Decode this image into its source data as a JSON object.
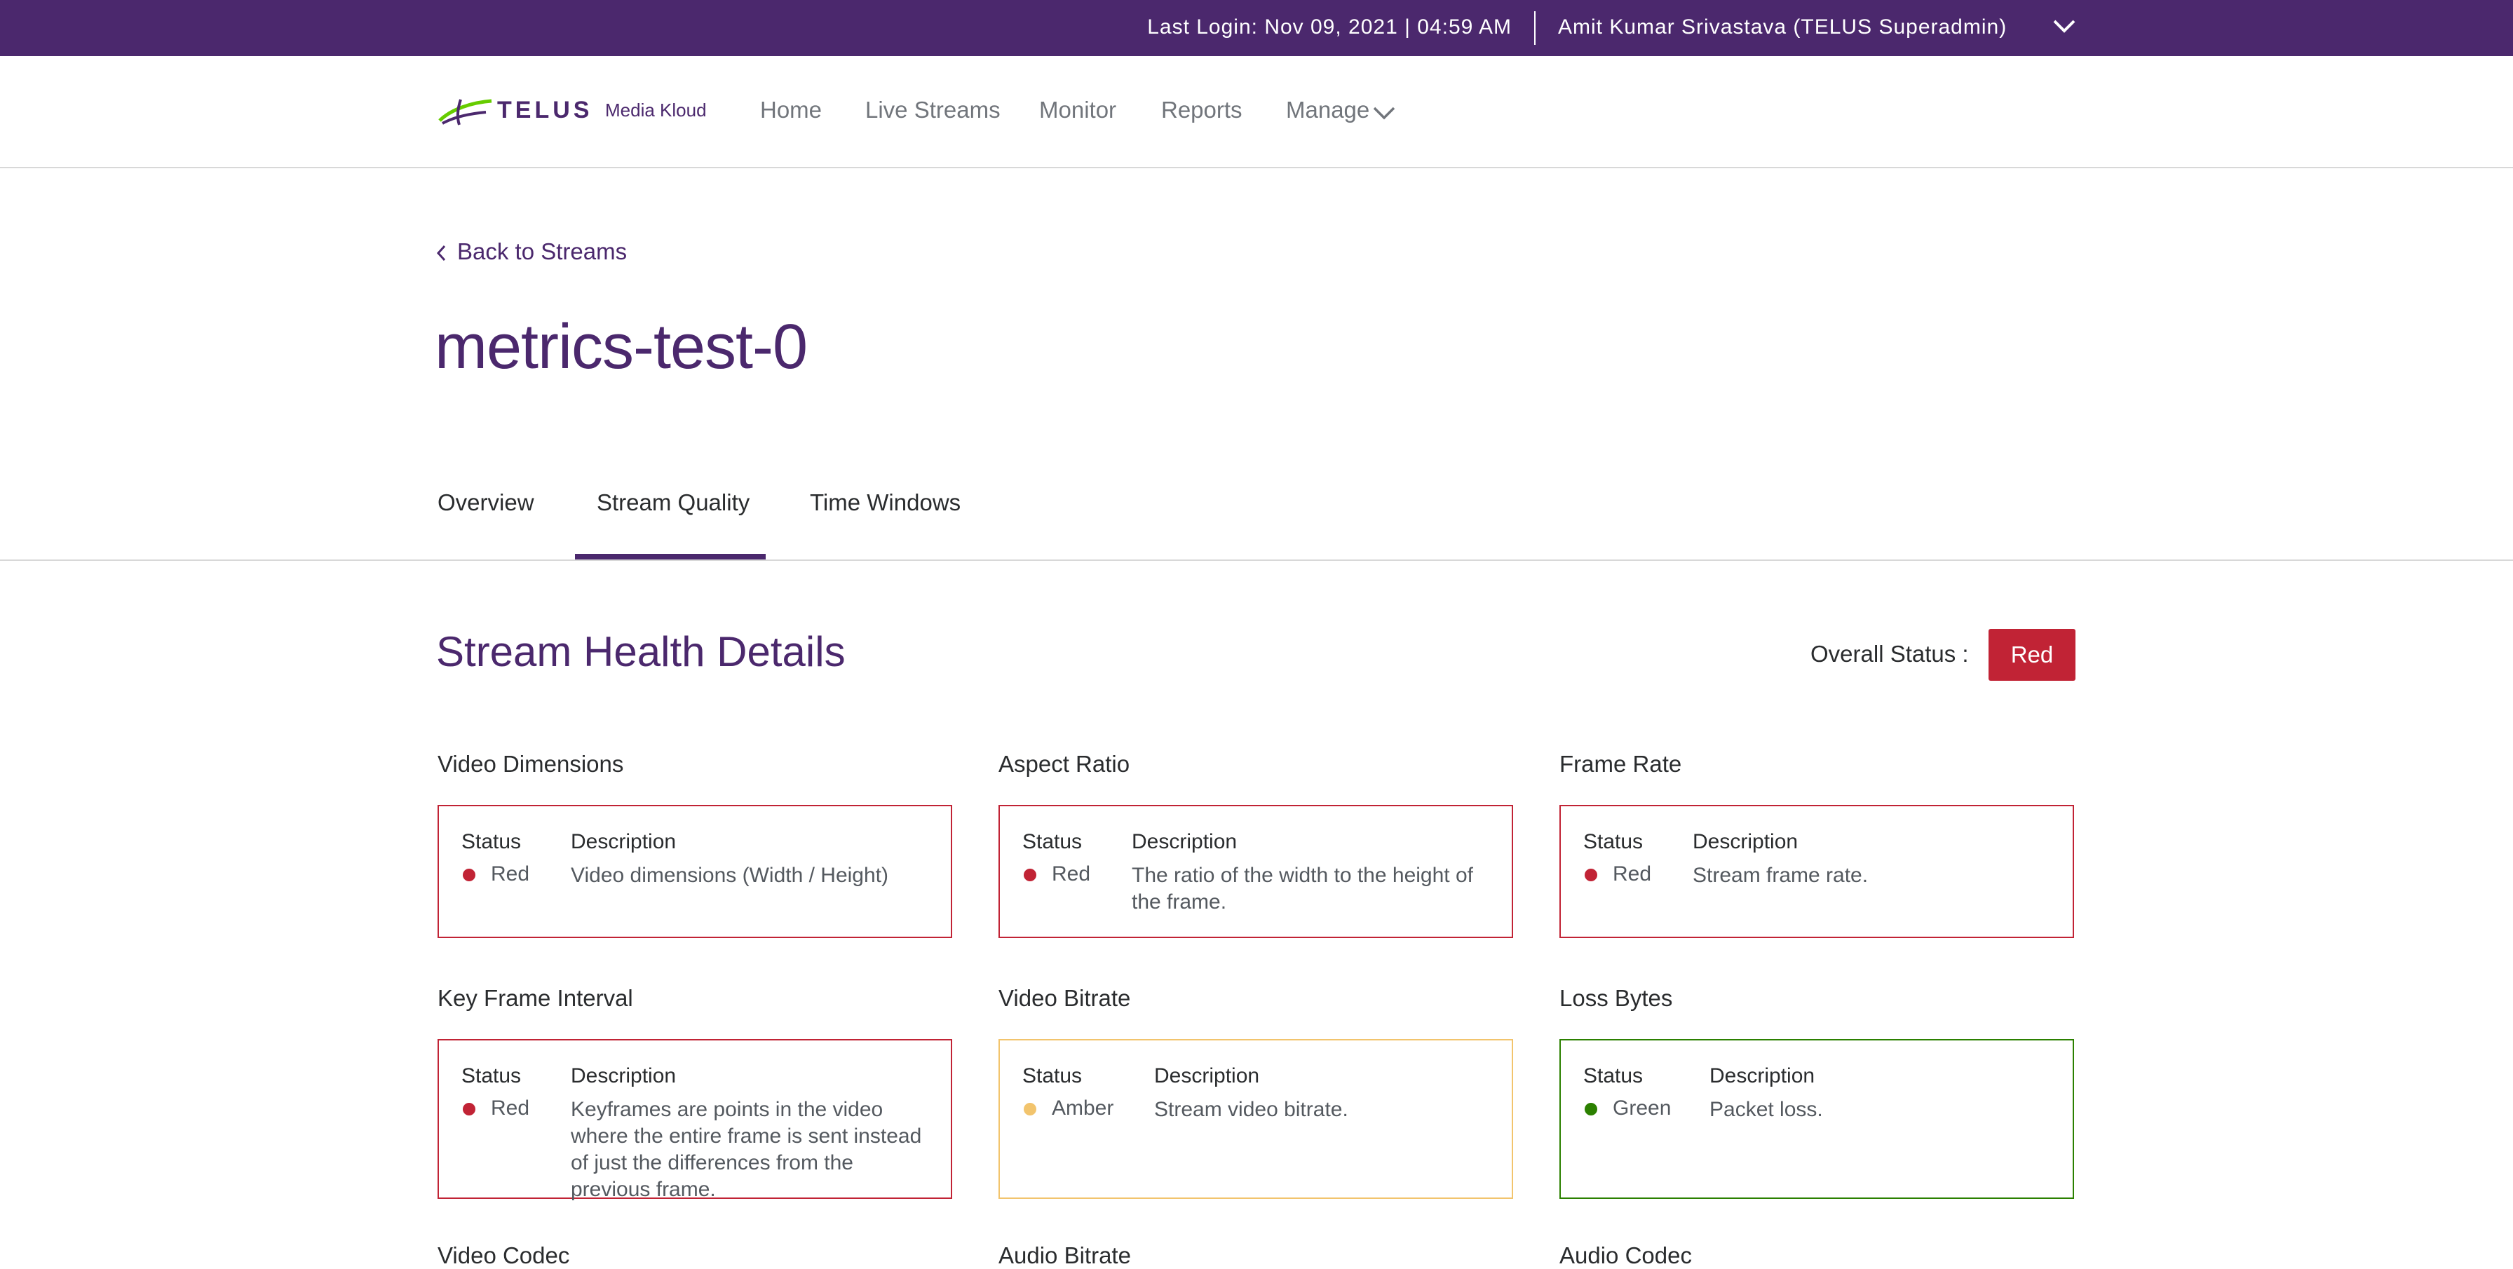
{
  "topbar": {
    "last_login": "Last Login: Nov 09, 2021 | 04:59 AM",
    "user": "Amit Kumar Srivastava (TELUS Superadmin)"
  },
  "brand": {
    "name": "TELUS",
    "product": "Media Kloud"
  },
  "nav": {
    "home": "Home",
    "live_streams": "Live Streams",
    "monitor": "Monitor",
    "reports": "Reports",
    "manage": "Manage"
  },
  "back_link": "Back to Streams",
  "page_title": "metrics-test-0",
  "tabs": {
    "overview": "Overview",
    "stream_quality": "Stream Quality",
    "time_windows": "Time Windows"
  },
  "section": {
    "title": "Stream Health Details",
    "overall_label": "Overall Status :",
    "overall_value": "Red"
  },
  "colors": {
    "red": "#c12335",
    "amber": "#f2c46d",
    "green": "#2b8000",
    "brand": "#4b286d"
  },
  "labels": {
    "status": "Status",
    "description": "Description"
  },
  "metrics": [
    {
      "title": "Video Dimensions",
      "status": "Red",
      "description": "Video dimensions (Width / Height)"
    },
    {
      "title": "Aspect Ratio",
      "status": "Red",
      "description": "The ratio of the width to the height of the frame."
    },
    {
      "title": "Frame Rate",
      "status": "Red",
      "description": "Stream frame rate."
    },
    {
      "title": "Key Frame Interval",
      "status": "Red",
      "description": "Keyframes are points in the video where the entire frame is sent instead of just the differences from the previous frame."
    },
    {
      "title": "Video Bitrate",
      "status": "Amber",
      "description": "Stream video bitrate."
    },
    {
      "title": "Loss Bytes",
      "status": "Green",
      "description": "Packet loss."
    },
    {
      "title": "Video Codec"
    },
    {
      "title": "Audio Bitrate"
    },
    {
      "title": "Audio Codec"
    }
  ]
}
